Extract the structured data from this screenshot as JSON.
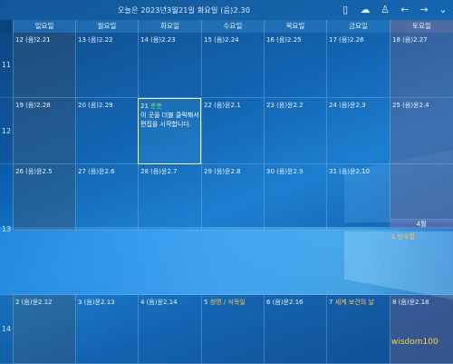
{
  "header": {
    "title": "오늘은 2023년3월21일 화요일 (음)2.30"
  },
  "toolbar_icons": [
    "mobile-icon",
    "cloud-icon",
    "user-icon",
    "arrow-left-icon",
    "arrow-right-icon",
    "chevron-down-icon"
  ],
  "weekdays": [
    "일요일",
    "월요일",
    "화요일",
    "수요일",
    "목요일",
    "금요일",
    "토요일"
  ],
  "weeks": [
    {
      "label": "11",
      "days": [
        {
          "date": "12 (음)2.21"
        },
        {
          "date": "13 (음)2.22"
        },
        {
          "date": "14 (음)2.23"
        },
        {
          "date": "15 (음)2.24"
        },
        {
          "date": "16 (음)2.25"
        },
        {
          "date": "17 (음)2.26"
        },
        {
          "date": "18 (음)2.27"
        }
      ]
    },
    {
      "label": "12",
      "days": [
        {
          "date": "19 (음)2.28"
        },
        {
          "date": "20 (음)2.29"
        },
        {
          "date": "21",
          "event": "춘분",
          "note": "이 곳을 더블 클릭해서 편집을 시작합니다."
        },
        {
          "date": "22 (음)윤2.1"
        },
        {
          "date": "23 (음)윤2.2"
        },
        {
          "date": "24 (음)윤2.3"
        },
        {
          "date": "25 (음)윤2.4"
        }
      ]
    },
    {
      "label": "13",
      "days": [
        {
          "date": "26 (음)윤2.5"
        },
        {
          "date": "27 (음)윤2.6"
        },
        {
          "date": "28 (음)윤2.7"
        },
        {
          "date": "29 (음)윤2.8"
        },
        {
          "date": "30 (음)윤2.9"
        },
        {
          "date": "31 (음)윤2.10"
        },
        {
          "date": ""
        }
      ]
    },
    {
      "label": "14",
      "days": [
        {
          "date": "2 (음)윤2.12"
        },
        {
          "date": "3 (음)윤2.13"
        },
        {
          "date": "4 (음)윤2.14"
        },
        {
          "date": "5",
          "event": "청명 / 식목일"
        },
        {
          "date": "6 (음)윤2.16"
        },
        {
          "date": "7",
          "event": "세계 보건의 날"
        },
        {
          "date": "8 (음)윤2.18"
        }
      ]
    }
  ],
  "april": {
    "label": "4월",
    "event": "1 만우절"
  },
  "watermark": "wisdom100"
}
